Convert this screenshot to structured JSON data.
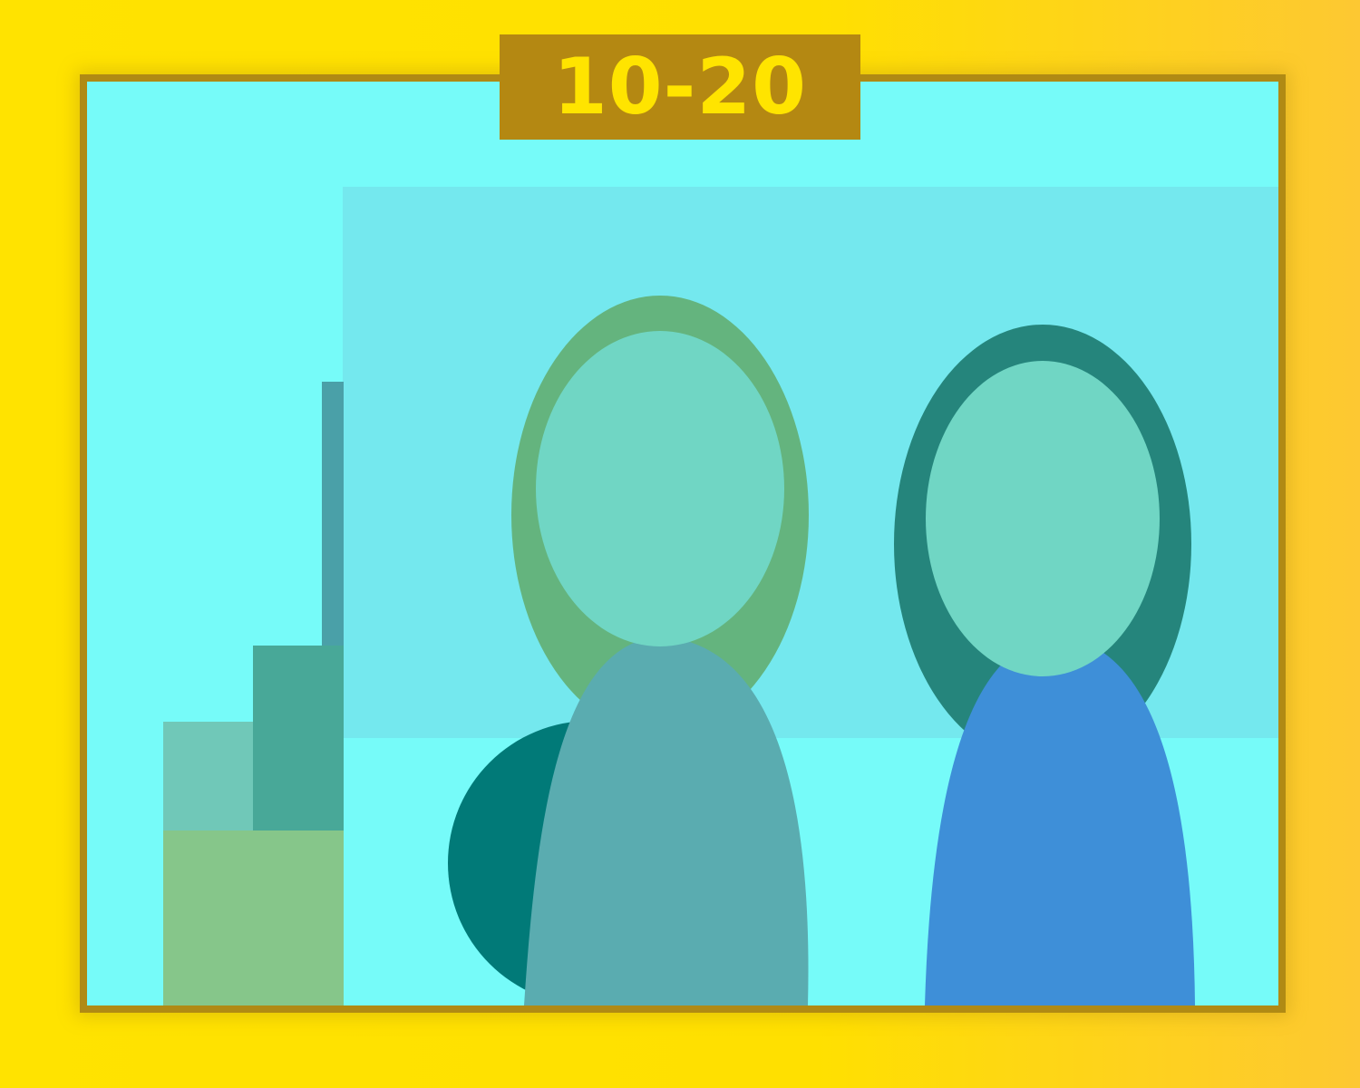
{
  "title": {
    "text": "10-20"
  },
  "colors": {
    "background_left": "#ffe300",
    "background_right": "#fdc832",
    "frame_border": "#b08a14",
    "plate_background": "#b48812",
    "plate_text": "#ffe400",
    "sky": "#76fbf9",
    "back_wall": "#74e8ee",
    "person_left_hair": "#64b47e",
    "person_left_face": "#70d6c4",
    "person_left_body": "#5aacb0",
    "person_right_hair": "#25857c",
    "person_right_face": "#70d6c4",
    "person_right_body": "#3e8fd8",
    "ball": "#017a78",
    "boxes": [
      "#70c8b8",
      "#48a898",
      "#86c68a"
    ],
    "pole": "#4aa0a8"
  }
}
